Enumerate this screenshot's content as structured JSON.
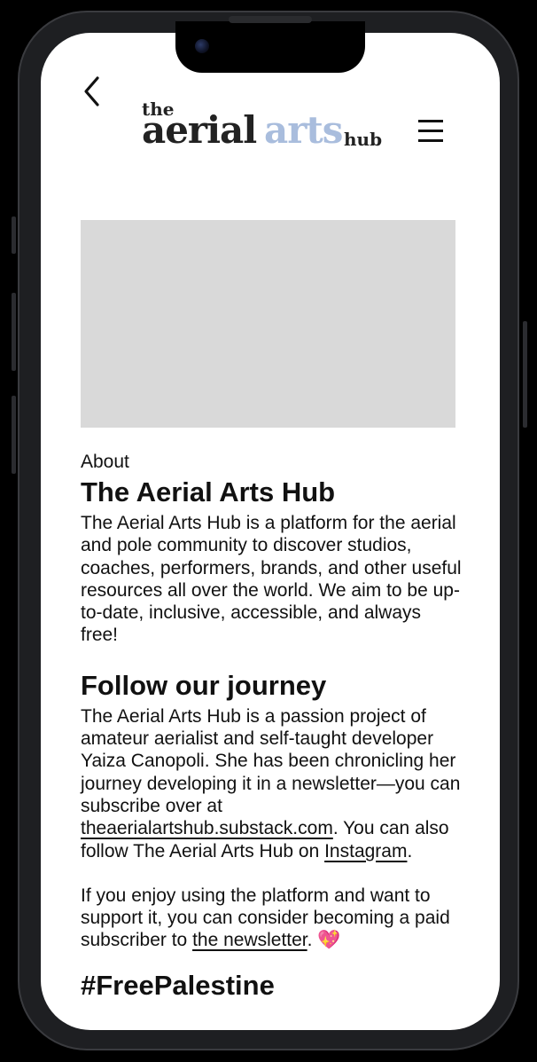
{
  "header": {
    "back_icon": "chevron-left-icon",
    "logo": {
      "the": "the",
      "aerial": "aerial",
      "arts": "arts",
      "hub": "hub",
      "accent_color": "#a9bddd"
    },
    "menu_icon": "hamburger-menu-icon"
  },
  "hero": {
    "placeholder_color": "#d9d9d9"
  },
  "about": {
    "eyebrow": "About",
    "title": "The Aerial Arts Hub",
    "body": "The Aerial Arts Hub is a platform for the aerial and pole community to discover studios, coaches, performers, brands, and other useful resources all over the world. We aim to be up-to-date, inclusive, accessible, and always free!"
  },
  "journey": {
    "title": "Follow our journey",
    "p1_before": "The Aerial Arts Hub is a passion project of amateur aerialist and self-taught developer Yaiza Canopoli. She has been chronicling her journey developing it in a newsletter—you can subscribe over at ",
    "p1_link1": "theaerialartshub.substack.com",
    "p1_middle": ". You can also follow The Aerial Arts Hub on ",
    "p1_link2": "Instagram",
    "p1_end": ".",
    "p2_before": "If you enjoy using the platform and want to support it, you can consider becoming a paid subscriber to ",
    "p2_link": "the newsletter",
    "p2_end": ". ",
    "p2_emoji": "💖"
  },
  "next_section": {
    "title_partial": "#FreePalestine"
  }
}
